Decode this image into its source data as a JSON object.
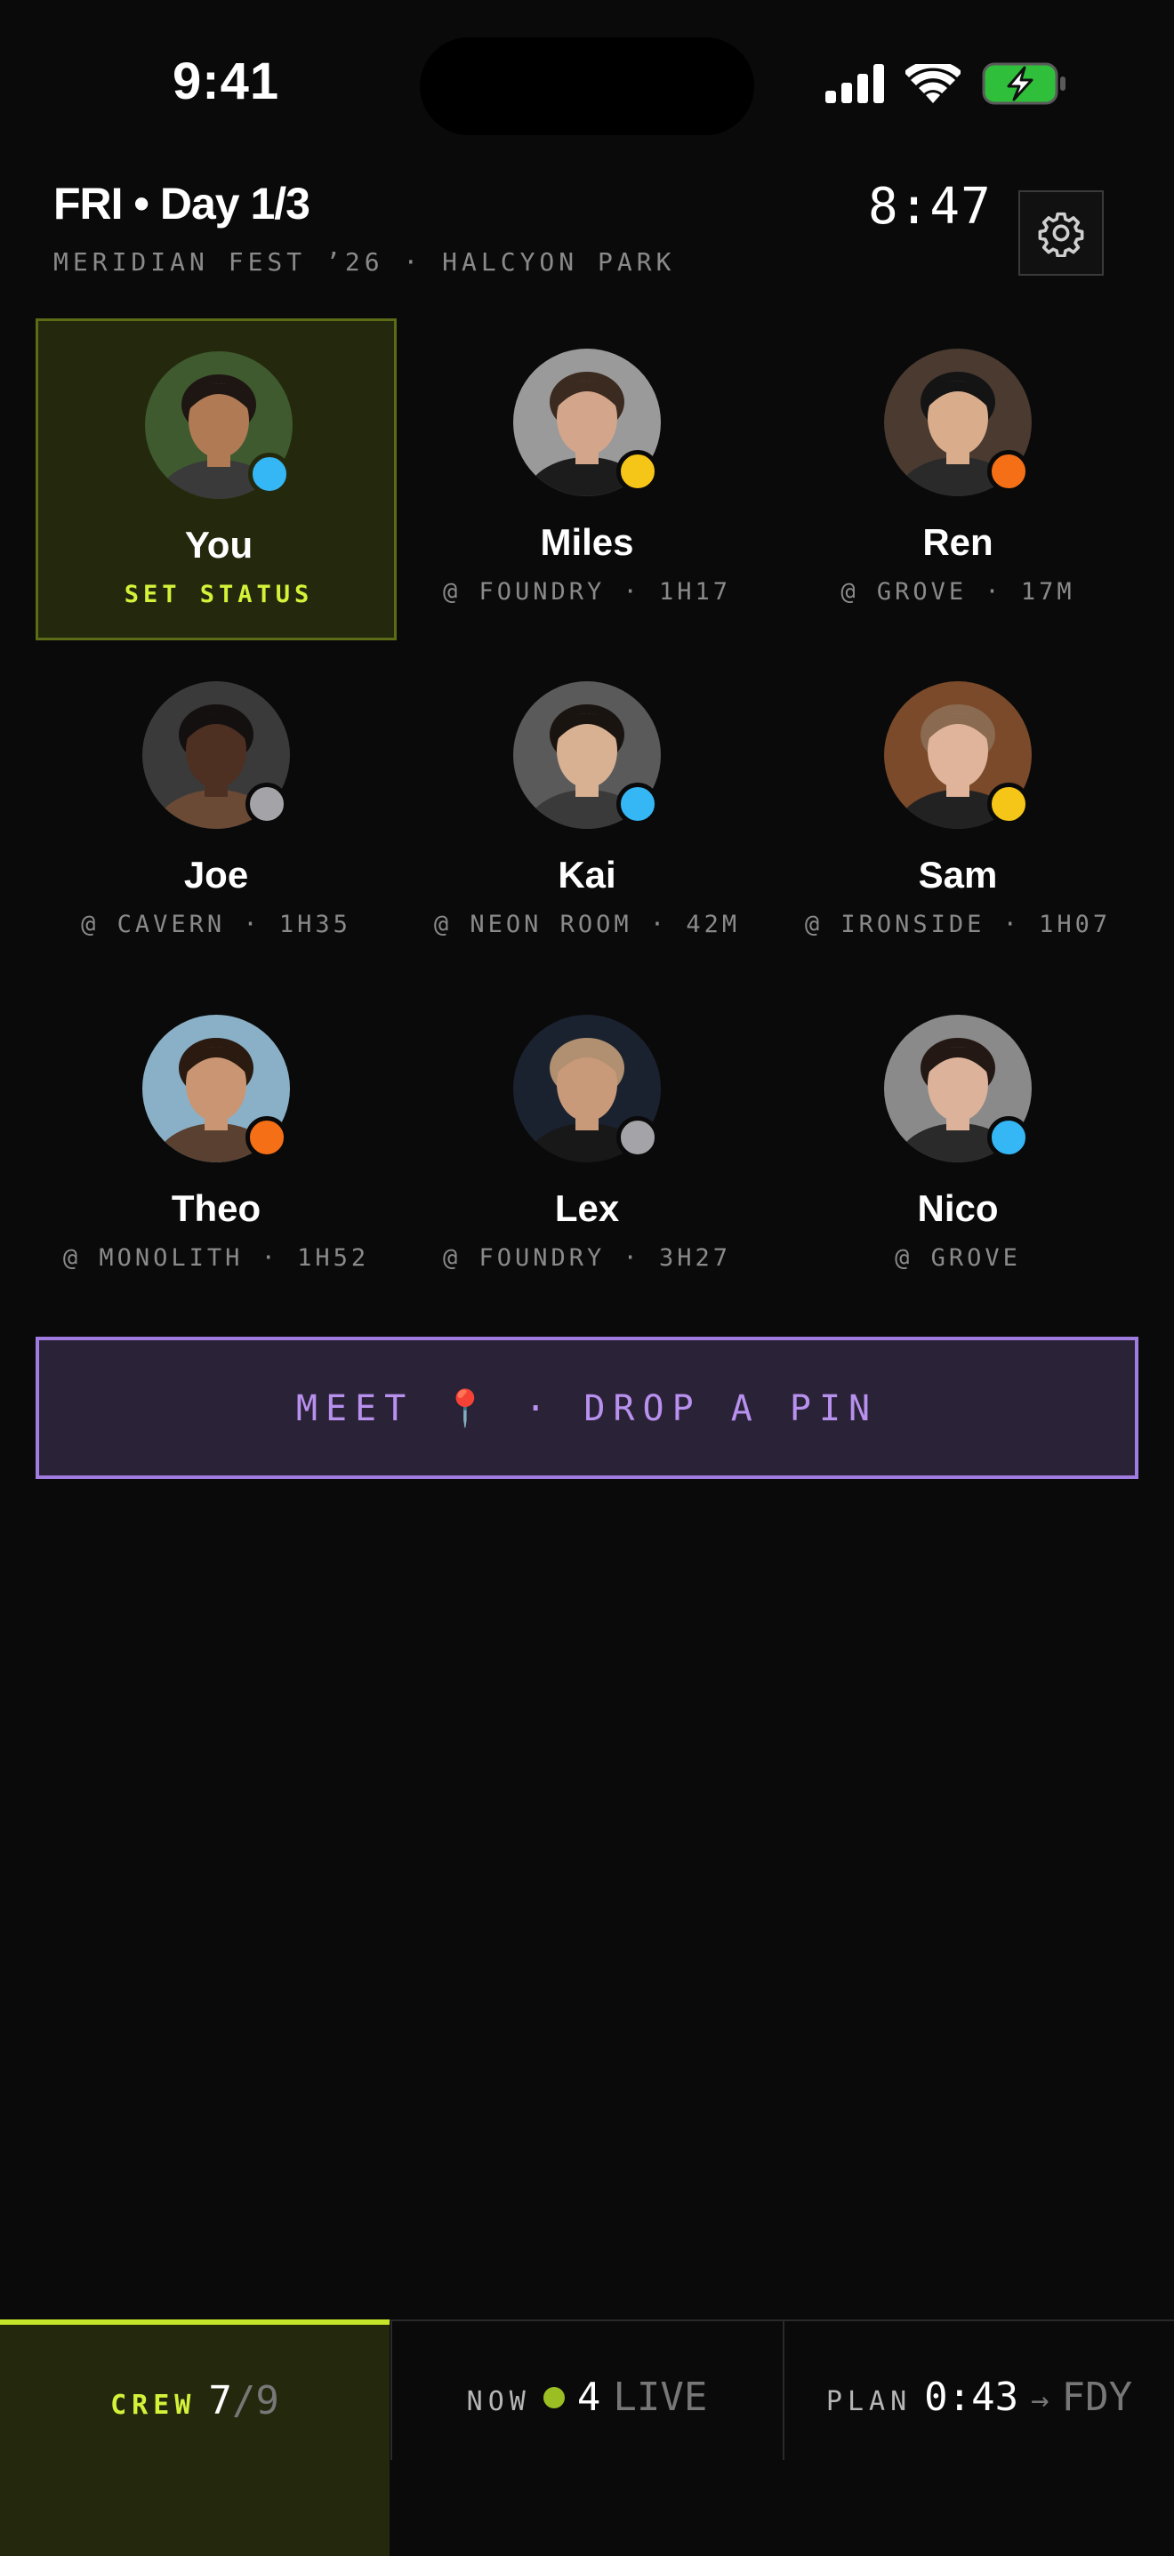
{
  "status_bar": {
    "time": "9:41"
  },
  "header": {
    "title": "FRI • Day 1/3",
    "subtitle": "MERIDIAN FEST ’26 · HALCYON PARK",
    "clock": "8:47"
  },
  "colors": {
    "accent": "#d4f23a",
    "meet": "#b890ee",
    "blue": "#35b6f5",
    "yellow": "#f5c518",
    "orange": "#f56f16",
    "gray": "#a3a3a8"
  },
  "crew": [
    {
      "name": "You",
      "location": "SET STATUS",
      "status_color": "#35b6f5",
      "skin": "#b07a55",
      "hair": "#1e1612",
      "shirt": "#3a3a3a",
      "bg": "#3f5a2e"
    },
    {
      "name": "Miles",
      "location": "@ FOUNDRY · 1H17",
      "status_color": "#f5c518",
      "skin": "#d3a58a",
      "hair": "#3b2a1f",
      "shirt": "#1c1c1c",
      "bg": "#9a9a9a"
    },
    {
      "name": "Ren",
      "location": "@ GROVE · 17M",
      "status_color": "#f56f16",
      "skin": "#d9ad8c",
      "hair": "#141414",
      "shirt": "#2a2a2a",
      "bg": "#4a3a30"
    },
    {
      "name": "Joe",
      "location": "@ CAVERN · 1H35",
      "status_color": "#a3a3a8",
      "skin": "#4e3022",
      "hair": "#151010",
      "shirt": "#6a4a35",
      "bg": "#3a3a3a"
    },
    {
      "name": "Kai",
      "location": "@ NEON ROOM · 42M",
      "status_color": "#35b6f5",
      "skin": "#d8b092",
      "hair": "#1a1410",
      "shirt": "#3a3a3a",
      "bg": "#5a5a5a"
    },
    {
      "name": "Sam",
      "location": "@ IRONSIDE · 1H07",
      "status_color": "#f5c518",
      "skin": "#e0b49a",
      "hair": "#8a6a50",
      "shirt": "#222",
      "bg": "#7a4a2a"
    },
    {
      "name": "Theo",
      "location": "@ MONOLITH · 1H52",
      "status_color": "#f56f16",
      "skin": "#c99572",
      "hair": "#2a1a10",
      "shirt": "#5a4030",
      "bg": "#8ab0c8"
    },
    {
      "name": "Lex",
      "location": "@ FOUNDRY · 3H27",
      "status_color": "#a3a3a8",
      "skin": "#c89a7a",
      "hair": "#b09070",
      "shirt": "#181818",
      "bg": "#1a2230"
    },
    {
      "name": "Nico",
      "location": "@ GROVE",
      "status_color": "#35b6f5",
      "skin": "#dcb29a",
      "hair": "#241814",
      "shirt": "#2a2a2a",
      "bg": "#8a8a8a"
    }
  ],
  "meet_button": {
    "label": "MEET 📍 · DROP A PIN"
  },
  "tabs": {
    "crew": {
      "label": "CREW",
      "value": "7",
      "total": "/9"
    },
    "now": {
      "label": "NOW",
      "value": "4",
      "suffix": "LIVE"
    },
    "plan": {
      "label": "PLAN",
      "value": "0:43",
      "arrow": "→",
      "suffix": "FDY"
    }
  }
}
